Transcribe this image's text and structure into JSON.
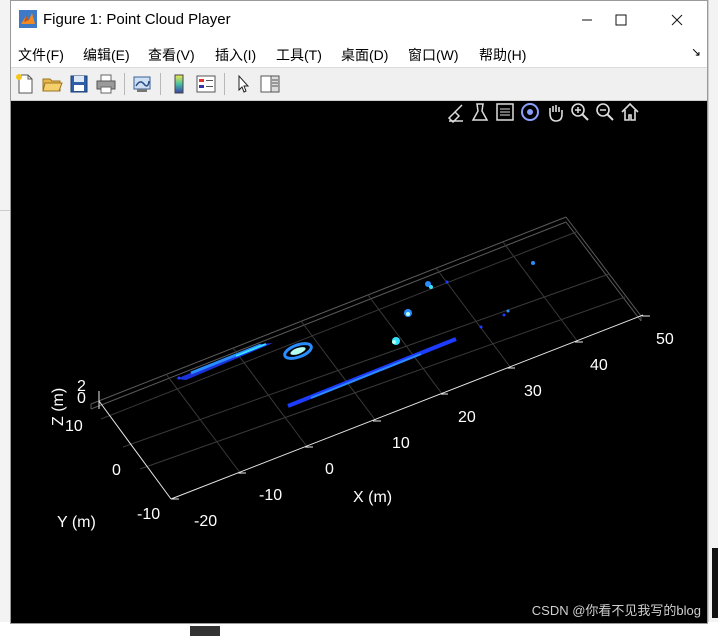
{
  "window": {
    "title": "Figure 1: Point Cloud Player"
  },
  "menu": [
    {
      "id": "file",
      "label": "文件(F)"
    },
    {
      "id": "edit",
      "label": "编辑(E)"
    },
    {
      "id": "view",
      "label": "查看(V)"
    },
    {
      "id": "insert",
      "label": "插入(I)"
    },
    {
      "id": "tools",
      "label": "工具(T)"
    },
    {
      "id": "desktop",
      "label": "桌面(D)"
    },
    {
      "id": "window",
      "label": "窗口(W)"
    },
    {
      "id": "help",
      "label": "帮助(H)"
    }
  ],
  "menu_overflow": "↘",
  "toolbar": {
    "buttons": [
      "new-figure-icon",
      "open-file-icon",
      "save-icon",
      "print-icon",
      "link-plot-icon",
      "insert-colorbar-icon",
      "insert-legend-icon",
      "edit-plot-cursor-icon",
      "property-inspector-icon"
    ]
  },
  "axes_toolbar": {
    "buttons": [
      "brush-icon",
      "data-tips-icon",
      "rotate-3d-icon",
      "pan-icon",
      "zoom-in-icon",
      "zoom-out-icon",
      "restore-view-icon"
    ]
  },
  "plot": {
    "x_label": "X (m)",
    "y_label": "Y (m)",
    "z_label": "Z (m)",
    "x_ticks": [
      "-20",
      "-10",
      "0",
      "10",
      "20",
      "30",
      "40",
      "50"
    ],
    "y_ticks": [
      "-10",
      "0",
      "10"
    ],
    "z_ticks": [
      "0",
      "2"
    ],
    "background": "#000000",
    "point_colors": [
      "#1e3cff",
      "#2a8dff",
      "#36e0ff",
      "#b6fff0"
    ]
  },
  "watermark": "CSDN @你看不见我写的blog"
}
